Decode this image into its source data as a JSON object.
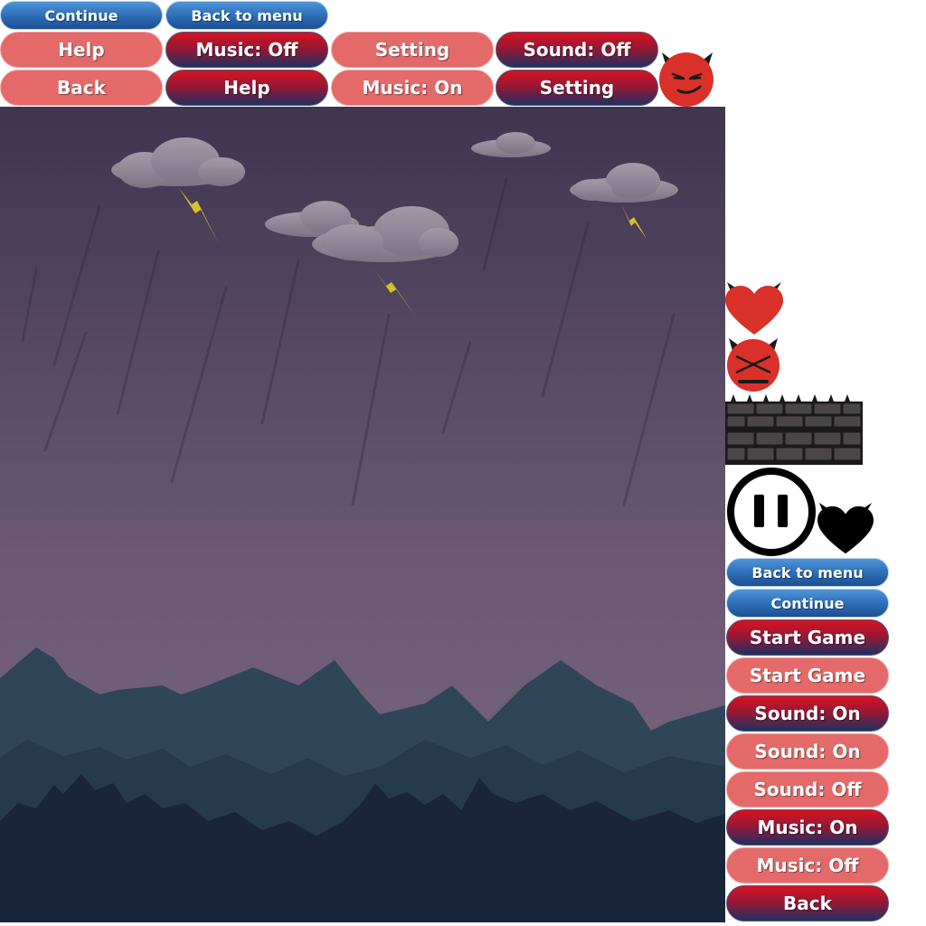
{
  "top_buttons": {
    "continue": "Continue",
    "back_to_menu": "Back to menu",
    "help_pink": "Help",
    "music_off": "Music: Off",
    "setting_pink": "Setting",
    "sound_off": "Sound: Off",
    "back_pink": "Back",
    "help_dark": "Help",
    "music_on": "Music: On",
    "setting_dark": "Setting"
  },
  "side_buttons": {
    "back_to_menu": "Back to menu",
    "continue": "Continue",
    "start_game_dark": "Start Game",
    "start_game_pink": "Start Game",
    "sound_on_dark": "Sound: On",
    "sound_on_pink": "Sound: On",
    "sound_off_pink": "Sound: Off",
    "music_on_dark": "Music: On",
    "music_off_pink": "Music: Off",
    "back_dark": "Back"
  },
  "icons": [
    "devil-face-icon",
    "devil-heart-icon",
    "devil-dead-face-icon",
    "brick-wall-spikes-icon",
    "pause-icon",
    "black-devil-heart-icon"
  ],
  "colors": {
    "blue_button": "#2f70b9",
    "pink_button": "#e46a6a",
    "dark_button_top": "#d8121f",
    "dark_button_bottom": "#1f3060",
    "sky_top": "#3f3550",
    "sky_bottom": "#7a6480",
    "devil_red": "#d9302a"
  }
}
